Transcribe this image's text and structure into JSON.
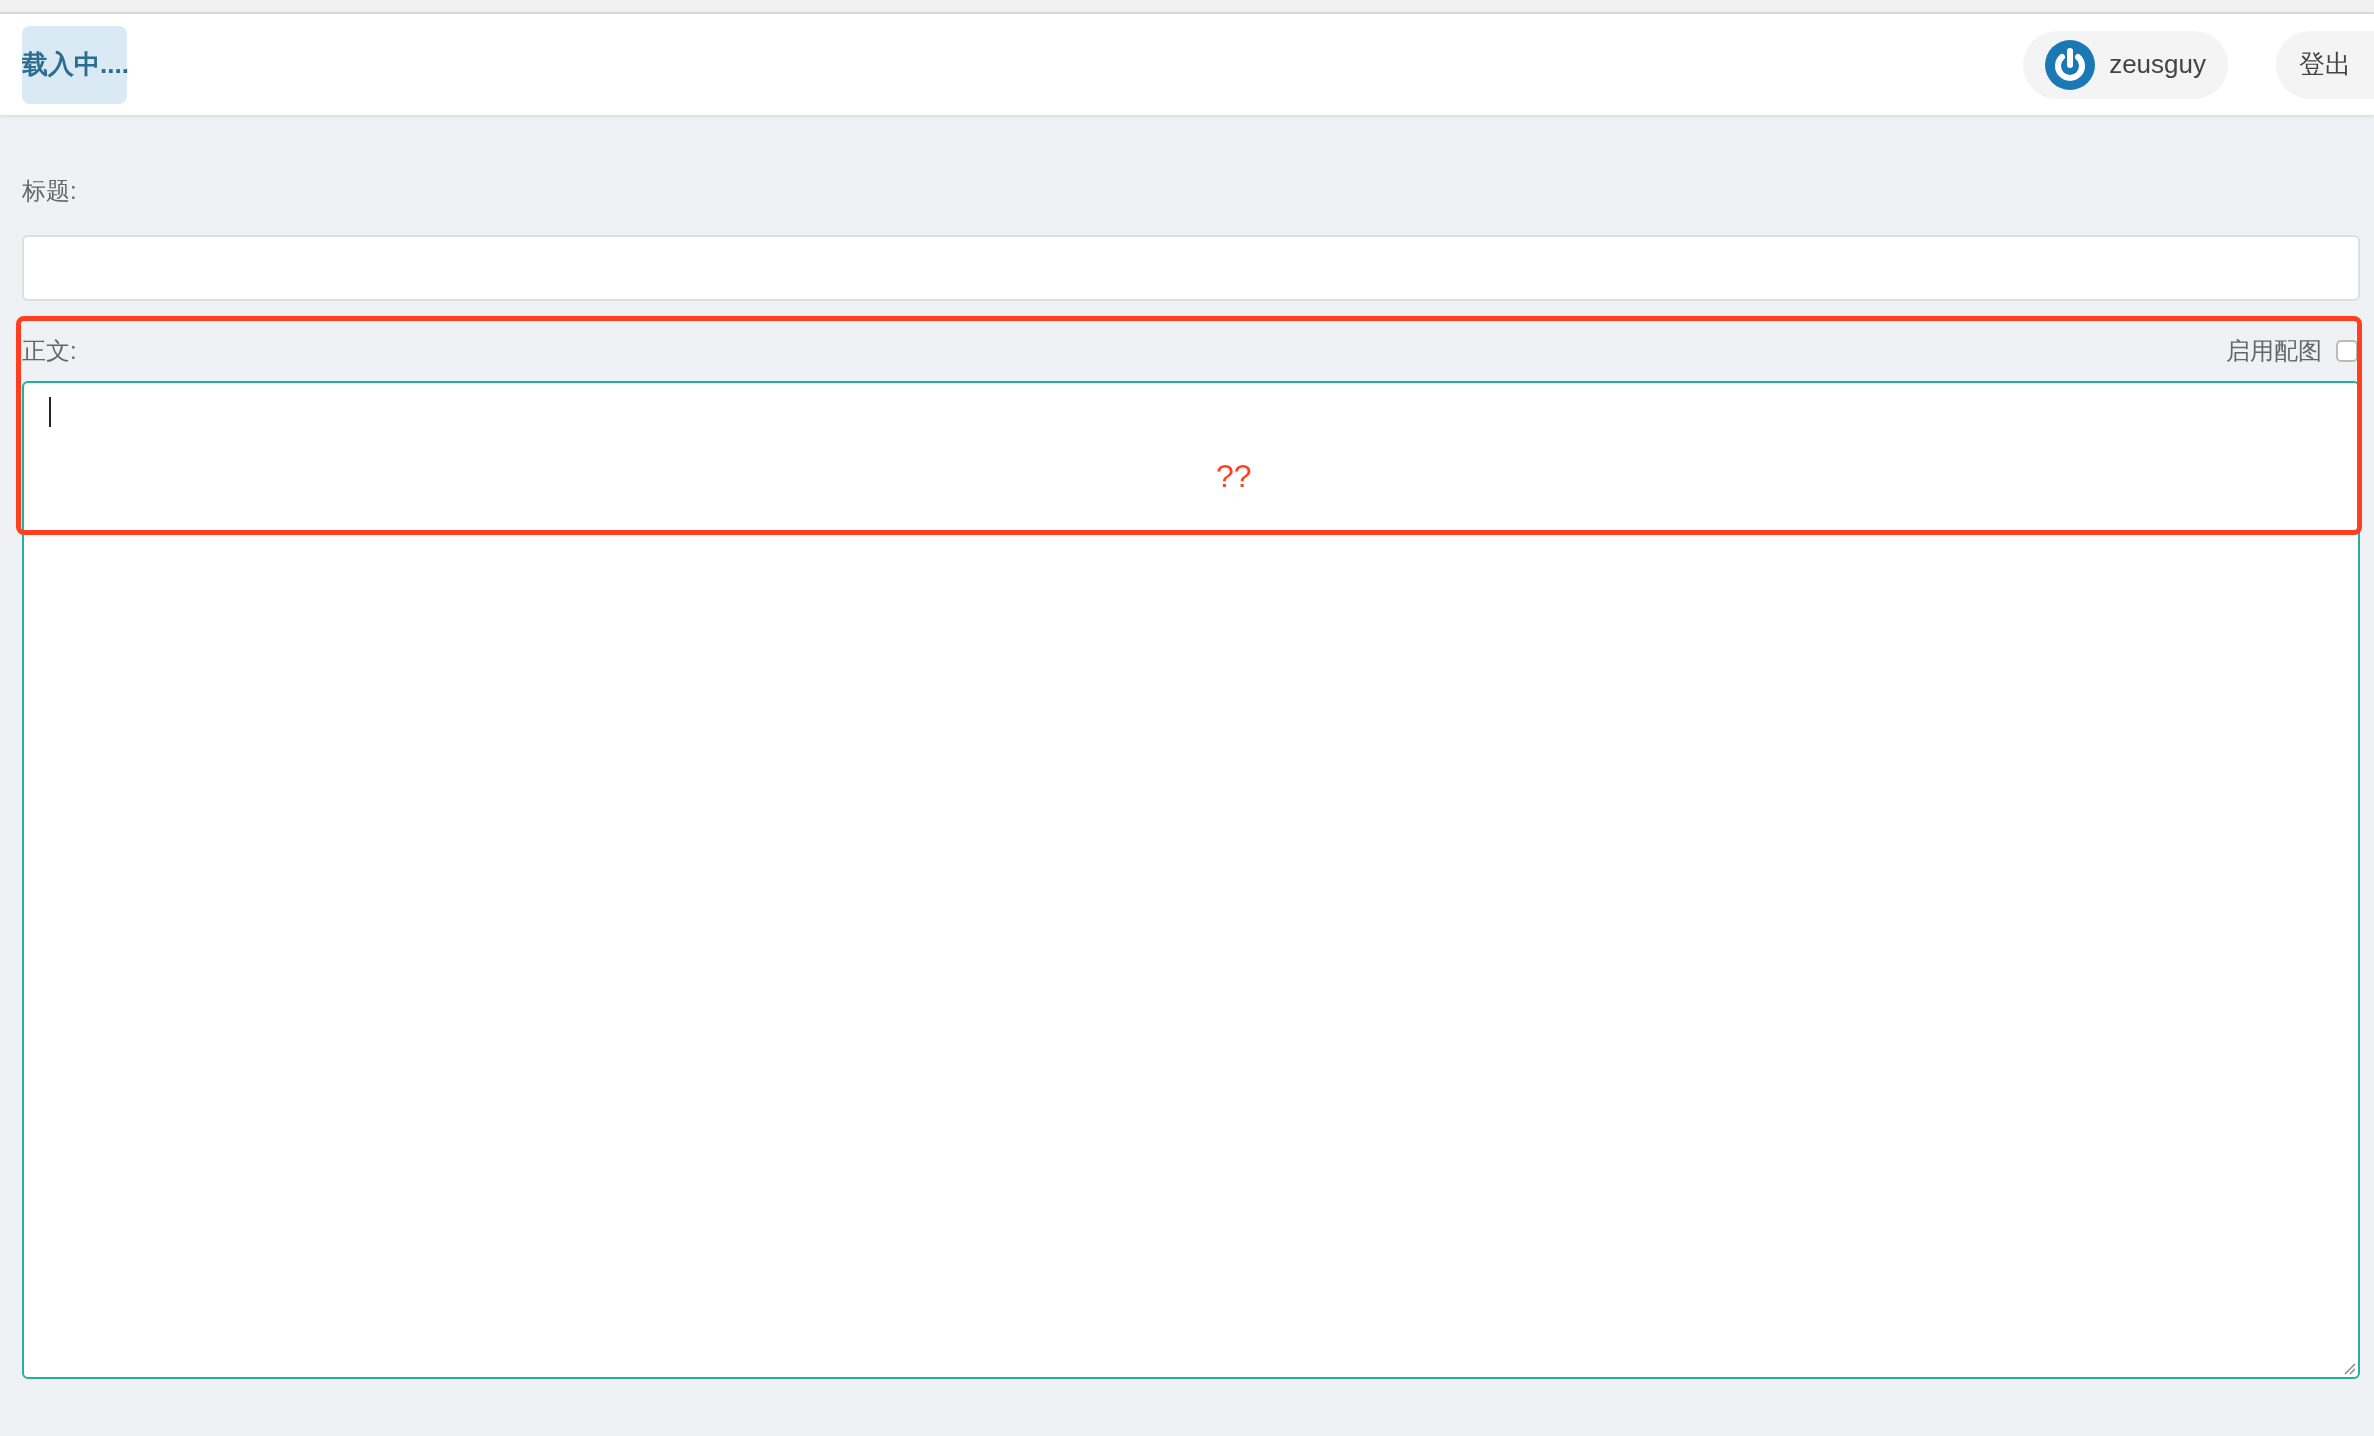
{
  "header": {
    "loading_badge": "载入中....",
    "user": {
      "name": "zeusguy"
    },
    "logout": "登出"
  },
  "form": {
    "title_label": "标题:",
    "body_label": "正文:",
    "image_option": {
      "label": "启用配图",
      "checked": false
    },
    "body_focused": true
  },
  "annotation": {
    "text": "??"
  }
}
